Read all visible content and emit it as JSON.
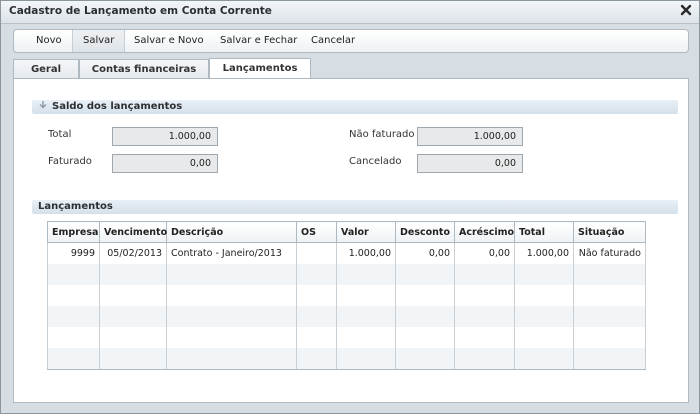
{
  "window": {
    "title": "Cadastro de Lançamento em Conta Corrente"
  },
  "toolbar": {
    "buttons": [
      "Novo",
      "Salvar",
      "Salvar e Novo",
      "Salvar e Fechar",
      "Cancelar"
    ],
    "active_index": 1
  },
  "tabs": [
    "Geral",
    "Contas financeiras",
    "Lançamentos"
  ],
  "active_tab": 2,
  "saldo": {
    "title": "Saldo dos lançamentos",
    "total_label": "Total",
    "total_value": "1.000,00",
    "faturado_label": "Faturado",
    "faturado_value": "0,00",
    "nao_faturado_label": "Não faturado",
    "nao_faturado_value": "1.000,00",
    "cancelado_label": "Cancelado",
    "cancelado_value": "0,00"
  },
  "lancamentos": {
    "title": "Lançamentos",
    "columns": [
      "Empresa",
      "Vencimento",
      "Descrição",
      "OS",
      "Valor",
      "Desconto",
      "Acréscimo",
      "Total",
      "Situação"
    ],
    "rows": [
      [
        "9999",
        "05/02/2013",
        "Contrato - Janeiro/2013",
        "",
        "1.000,00",
        "0,00",
        "0,00",
        "1.000,00",
        "Não faturado"
      ]
    ]
  }
}
